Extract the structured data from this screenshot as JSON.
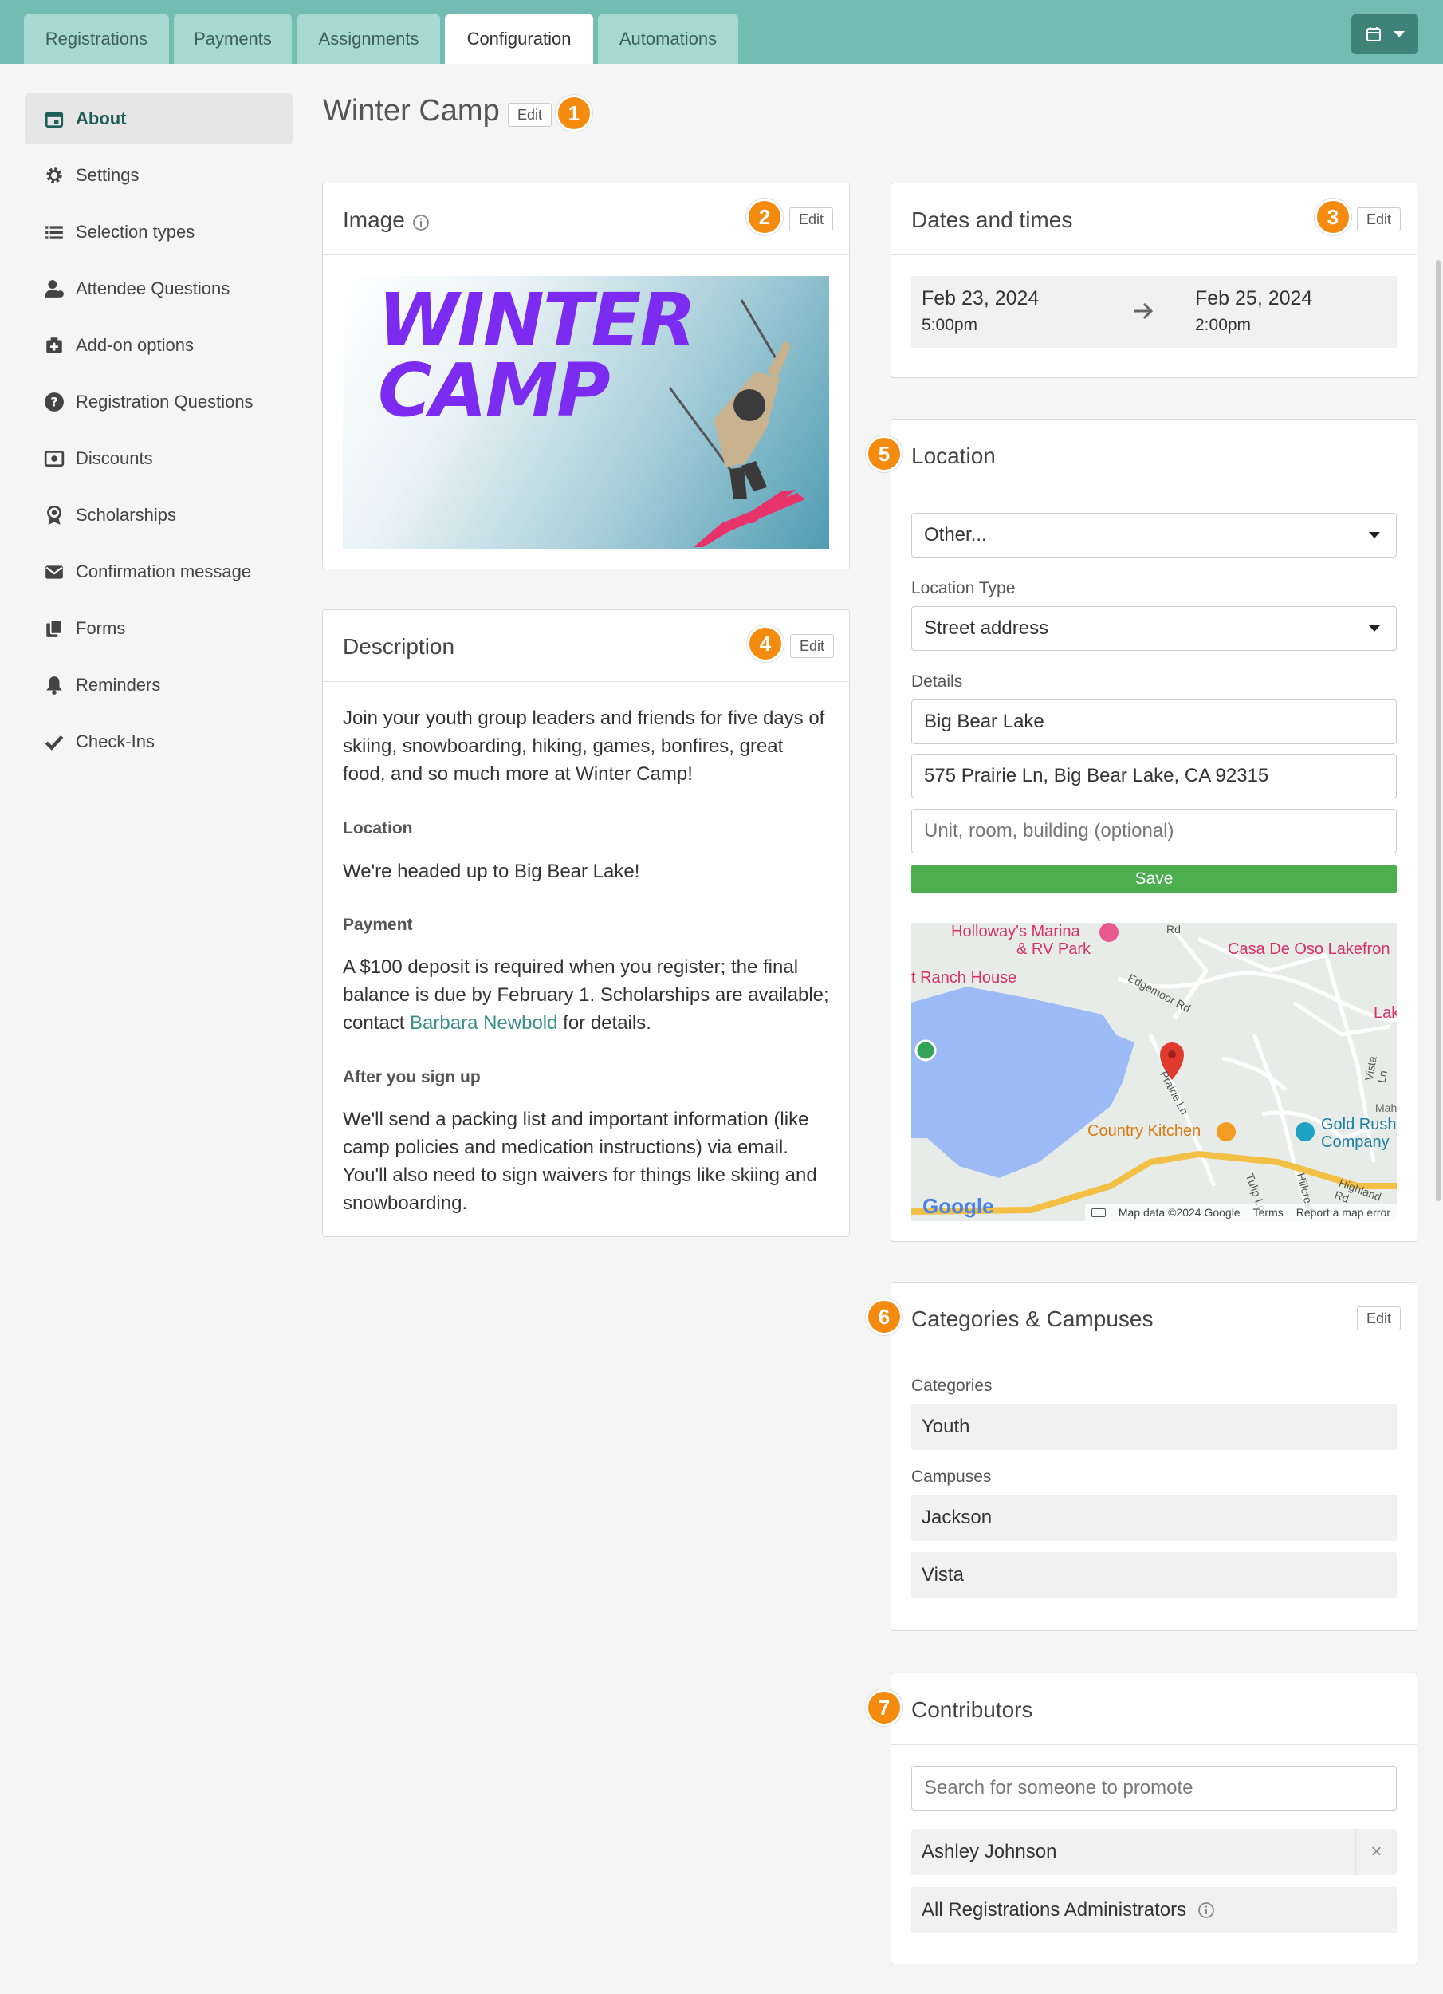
{
  "tabs": [
    "Registrations",
    "Payments",
    "Assignments",
    "Configuration",
    "Automations"
  ],
  "active_tab": "Configuration",
  "sidebar": {
    "items": [
      {
        "label": "About",
        "icon": "calendar-icon",
        "active": true
      },
      {
        "label": "Settings",
        "icon": "gear-icon"
      },
      {
        "label": "Selection types",
        "icon": "list-icon"
      },
      {
        "label": "Attendee Questions",
        "icon": "person-question-icon"
      },
      {
        "label": "Add-on options",
        "icon": "add-box-icon"
      },
      {
        "label": "Registration Questions",
        "icon": "question-circle-icon"
      },
      {
        "label": "Discounts",
        "icon": "discount-icon"
      },
      {
        "label": "Scholarships",
        "icon": "award-icon"
      },
      {
        "label": "Confirmation message",
        "icon": "envelope-icon"
      },
      {
        "label": "Forms",
        "icon": "documents-icon"
      },
      {
        "label": "Reminders",
        "icon": "bell-icon"
      },
      {
        "label": "Check-Ins",
        "icon": "checkmark-icon"
      }
    ]
  },
  "page": {
    "title": "Winter Camp",
    "edit_label": "Edit"
  },
  "markers": [
    "1",
    "2",
    "3",
    "4",
    "5",
    "6",
    "7"
  ],
  "image_panel": {
    "title": "Image",
    "edit_label": "Edit",
    "banner_text": [
      "WINTER",
      "CAMP"
    ]
  },
  "description_panel": {
    "title": "Description",
    "edit_label": "Edit",
    "intro": "Join your youth group leaders and friends for five days of skiing, snowboarding, hiking, games, bonfires, great food, and so much more at Winter Camp!",
    "location_heading": "Location",
    "location_text": "We're headed up to Big Bear Lake!",
    "payment_heading": "Payment",
    "payment_text_before": "A $100 deposit is required when you register; the final balance is due by February 1. Scholarships are available; contact ",
    "payment_link": "Barbara Newbold",
    "payment_text_after": " for details.",
    "after_heading": "After you sign up",
    "after_text": "We'll send a packing list and important information (like camp policies and medication instructions) via email. You'll also need to sign waivers for things like skiing and snowboarding."
  },
  "dates_panel": {
    "title": "Dates and times",
    "edit_label": "Edit",
    "start_date": "Feb 23, 2024",
    "start_time": "5:00pm",
    "end_date": "Feb 25, 2024",
    "end_time": "2:00pm"
  },
  "location_panel": {
    "title": "Location",
    "location_select": "Other...",
    "location_type_label": "Location Type",
    "location_type": "Street address",
    "details_label": "Details",
    "name_value": "Big Bear Lake",
    "address_value": "575 Prairie Ln, Big Bear Lake, CA 92315",
    "unit_placeholder": "Unit, room, building (optional)",
    "save_label": "Save",
    "map": {
      "labels": [
        "Holloway's Marina",
        "& RV Park",
        "Casa De Oso Lakefron",
        "t Ranch House",
        "Lak",
        "Country Kitchen",
        "Gold Rush",
        "Company",
        "Mah",
        "Edgemoor Rd",
        "Prairie Ln",
        "Vista Ln",
        "Tulip Ln",
        "Highland Rd",
        "Hillcrest",
        "Rd"
      ],
      "footer": [
        "Map data ©2024 Google",
        "Terms",
        "Report a map error"
      ],
      "logo": "Google"
    }
  },
  "categories_panel": {
    "title": "Categories & Campuses",
    "edit_label": "Edit",
    "categories_label": "Categories",
    "categories": [
      "Youth"
    ],
    "campuses_label": "Campuses",
    "campuses": [
      "Jackson",
      "Vista"
    ]
  },
  "contributors_panel": {
    "title": "Contributors",
    "search_placeholder": "Search for someone to promote",
    "people": [
      "Ashley Johnson"
    ],
    "remove_label": "×",
    "group": "All Registrations Administrators"
  },
  "colors": {
    "topbar": "#72bcb4",
    "accent": "#3a8f86",
    "marker": "#f48b0f",
    "save": "#4cae4f",
    "banner_text": "#7c2cf0"
  }
}
